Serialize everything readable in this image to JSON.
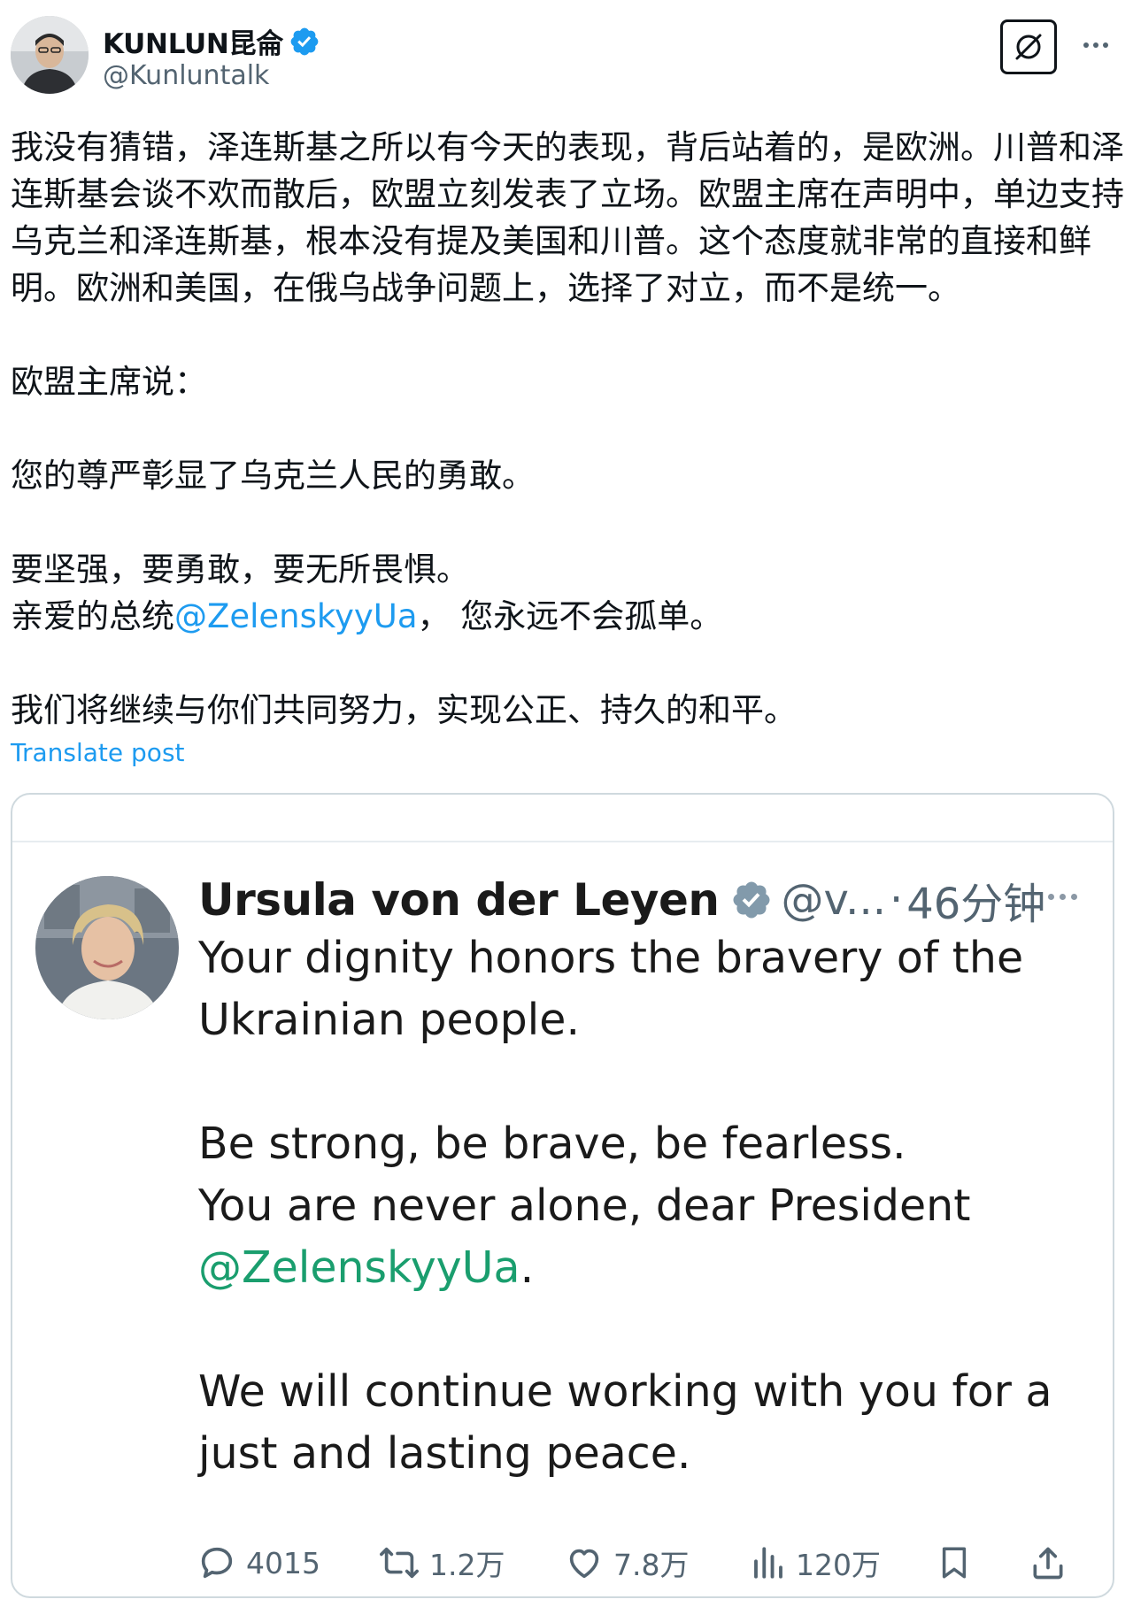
{
  "post": {
    "author": {
      "display_name": "KUNLUN昆侖",
      "handle": "@Kunluntalk",
      "verified": true,
      "avatar_icon": "avatar-photo"
    },
    "paragraph1": "我没有猜错，泽连斯基之所以有今天的表现，背后站着的，是欧洲。川普和泽连斯基会谈不欢而散后，欧盟立刻发表了立场。欧盟主席在声明中，单边支持乌克兰和泽连斯基，根本没有提及美国和川普。这个态度就非常的直接和鲜明。欧洲和美国，在俄乌战争问题上，选择了对立，而不是统一。",
    "paragraph2": "欧盟主席说：",
    "paragraph3": "您的尊严彰显了乌克兰人民的勇敢。",
    "paragraph4a": "要坚强，要勇敢，要无所畏惧。",
    "paragraph4b_prefix": "亲爱的总统",
    "paragraph4b_mention": "@ZelenskyyUa",
    "paragraph4b_suffix": "，  您永远不会孤单。",
    "paragraph5": "我们将继续与你们共同努力，实现公正、持久的和平。",
    "translate_label": "Translate post"
  },
  "quoted": {
    "author": {
      "display_name": "Ursula von der Leyen",
      "handle": "@v...",
      "separator": "·",
      "time": "46分钟",
      "verified": true
    },
    "line1": "Your dignity honors the bravery of the Ukrainian people.",
    "line2": "Be strong, be brave, be fearless.",
    "line3_prefix": "You are never alone, dear President ",
    "line3_mention": "@ZelenskyyUa",
    "line3_suffix": ".",
    "line4": "We will continue working with you for a just and lasting peace.",
    "stats": {
      "replies": "4015",
      "reposts": "1.2万",
      "likes": "7.8万",
      "views": "120万"
    }
  },
  "colors": {
    "link": "#1d9bf0",
    "mention_quote": "#1a9e6e",
    "secondary_text": "#536471",
    "border": "#cfd9de",
    "verified": "#1d9bf0",
    "verified_quote": "#829aab"
  },
  "icons": [
    "verified-badge-icon",
    "grok-icon",
    "more-icon",
    "reply-icon",
    "repost-icon",
    "like-icon",
    "views-icon",
    "bookmark-icon",
    "share-icon"
  ]
}
